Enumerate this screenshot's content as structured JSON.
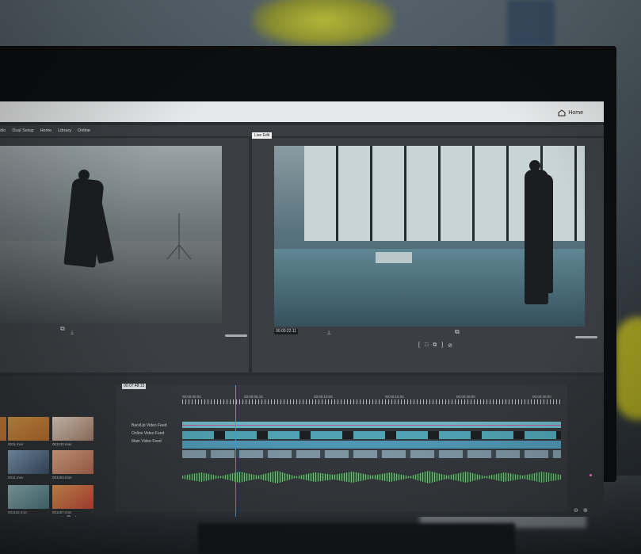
{
  "screen": {
    "home_label": "Home",
    "menu": [
      "Dual Setup",
      "Home",
      "Library",
      "Online"
    ],
    "menu_partial": "dio",
    "live_label": "Live Edit",
    "preview_timecode": "00:00:22:11",
    "timeline_timecode": "00:07:48:15",
    "ruler_marks": [
      "00:00:00:00",
      "00:00:05:15",
      "00:00:10:00",
      "00:00:15:00",
      "00:00:20:00",
      "00:00:25:00",
      "00:00:30:00"
    ],
    "tracks": [
      "BackUp Video Feed",
      "Online Video Feed",
      "Main Video Feed"
    ],
    "clips": [
      "0011.mov",
      "001132.mov",
      "0011.mov",
      "001153.mov",
      "0011.mov",
      "001152.mov",
      "001167.mov"
    ]
  },
  "colors": {
    "accent": "#3aa0d8",
    "track_teal": "#4fa3b3",
    "audio_green": "#7fc48a",
    "thumb_orange": "#d79a4a"
  }
}
